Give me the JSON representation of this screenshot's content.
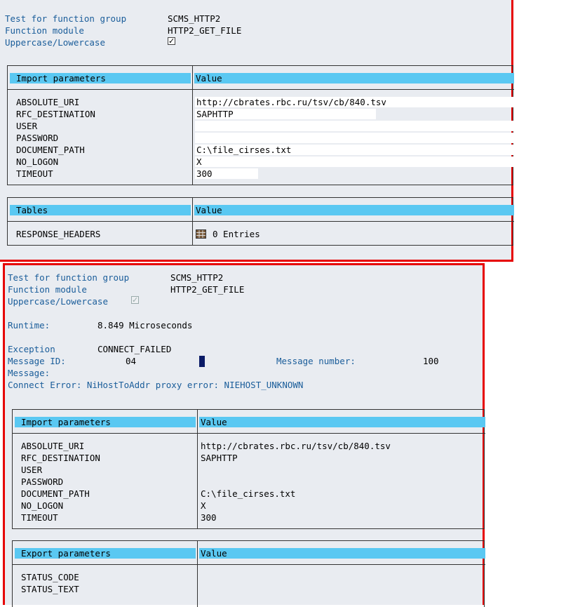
{
  "screen1": {
    "header": {
      "rows": [
        {
          "label": "Test for function group",
          "value": "SCMS_HTTP2"
        },
        {
          "label": "Function module",
          "value": "HTTP2_GET_FILE"
        },
        {
          "label": "Uppercase/Lowercase",
          "checked": true
        }
      ]
    },
    "import_params": {
      "title": "Import parameters",
      "value_header": "Value",
      "rows": [
        {
          "name": "ABSOLUTE_URI",
          "value": "http://cbrates.rbc.ru/tsv/cb/840.tsv"
        },
        {
          "name": "RFC_DESTINATION",
          "value": "SAPHTTP"
        },
        {
          "name": "USER",
          "value": ""
        },
        {
          "name": "PASSWORD",
          "value": ""
        },
        {
          "name": "DOCUMENT_PATH",
          "value": "C:\\file_cirses.txt"
        },
        {
          "name": "NO_LOGON",
          "value": "X"
        },
        {
          "name": "TIMEOUT",
          "value": "300"
        }
      ]
    },
    "tables": {
      "title": "Tables",
      "value_header": "Value",
      "rows": [
        {
          "name": "RESPONSE_HEADERS",
          "icon": "table-icon",
          "value": "0 Entries"
        }
      ]
    }
  },
  "screen2": {
    "header": {
      "rows": [
        {
          "label": "Test for function group",
          "value": "SCMS_HTTP2"
        },
        {
          "label": "Function module",
          "value": "HTTP2_GET_FILE"
        },
        {
          "label": "Uppercase/Lowercase",
          "checked": true
        }
      ]
    },
    "result": {
      "runtime_label": "Runtime:",
      "runtime_value": "8.849 Microseconds",
      "exception_label": "Exception",
      "exception_value": "CONNECT_FAILED",
      "message_id_label": "Message ID:",
      "message_id_value": "04",
      "message_number_label": "Message number:",
      "message_number_value": "100",
      "message_label": "Message:",
      "message_text": "Connect Error: NiHostToAddr proxy error: NIEHOST_UNKNOWN"
    },
    "import_params": {
      "title": "Import parameters",
      "value_header": "Value",
      "rows": [
        {
          "name": "ABSOLUTE_URI",
          "value": "http://cbrates.rbc.ru/tsv/cb/840.tsv"
        },
        {
          "name": "RFC_DESTINATION",
          "value": "SAPHTTP"
        },
        {
          "name": "USER",
          "value": ""
        },
        {
          "name": "PASSWORD",
          "value": ""
        },
        {
          "name": "DOCUMENT_PATH",
          "value": "C:\\file_cirses.txt"
        },
        {
          "name": "NO_LOGON",
          "value": "X"
        },
        {
          "name": "TIMEOUT",
          "value": "300"
        }
      ]
    },
    "export_params": {
      "title": "Export parameters",
      "value_header": "Value",
      "rows": [
        {
          "name": "STATUS_CODE",
          "value": ""
        },
        {
          "name": "STATUS_TEXT",
          "value": ""
        }
      ]
    }
  },
  "colors": {
    "highlight_border": "#e60000",
    "header_bar": "#5ac8f2",
    "background": "#e9ecf1",
    "label_blue": "#1a5d9a",
    "cursor": "#0a1a66"
  }
}
